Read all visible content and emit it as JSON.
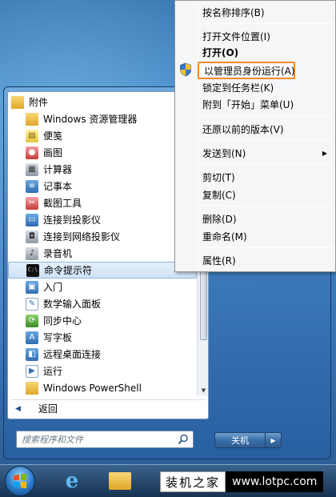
{
  "programs": {
    "folder_label": "附件",
    "items": [
      {
        "label": "Windows 资源管理器",
        "icon": "explorer-icon"
      },
      {
        "label": "便笺",
        "icon": "sticky-notes-icon"
      },
      {
        "label": "画图",
        "icon": "paint-icon"
      },
      {
        "label": "计算器",
        "icon": "calculator-icon"
      },
      {
        "label": "记事本",
        "icon": "notepad-icon"
      },
      {
        "label": "截图工具",
        "icon": "snipping-tool-icon"
      },
      {
        "label": "连接到投影仪",
        "icon": "projector-icon"
      },
      {
        "label": "连接到网络投影仪",
        "icon": "network-projector-icon"
      },
      {
        "label": "录音机",
        "icon": "microphone-icon"
      },
      {
        "label": "命令提示符",
        "icon": "cmd-icon",
        "selected": true
      },
      {
        "label": "入门",
        "icon": "getting-started-icon"
      },
      {
        "label": "数学输入面板",
        "icon": "math-input-icon"
      },
      {
        "label": "同步中心",
        "icon": "sync-icon"
      },
      {
        "label": "写字板",
        "icon": "wordpad-icon"
      },
      {
        "label": "远程桌面连接",
        "icon": "remote-desktop-icon"
      },
      {
        "label": "运行",
        "icon": "run-icon"
      },
      {
        "label": "Windows PowerShell",
        "icon": "folder-icon"
      }
    ],
    "cmd_icon_text": "C:\\",
    "back_label": "返回"
  },
  "search": {
    "placeholder": "搜索程序和文件"
  },
  "shutdown": {
    "label": "关机"
  },
  "context_menu": {
    "items": [
      {
        "label": "按名称排序(B)"
      },
      {
        "label": "打开文件位置(I)"
      },
      {
        "label": "打开(O)",
        "bold": true
      },
      {
        "label": "以管理员身份运行(A)",
        "highlighted": true,
        "icon": "uac-shield-icon"
      },
      {
        "label": "锁定到任务栏(K)"
      },
      {
        "label": "附到「开始」菜单(U)"
      },
      {
        "label": "还原以前的版本(V)"
      },
      {
        "label": "发送到(N)",
        "submenu": true
      },
      {
        "label": "剪切(T)"
      },
      {
        "label": "复制(C)"
      },
      {
        "label": "删除(D)"
      },
      {
        "label": "重命名(M)"
      },
      {
        "label": "属性(R)"
      }
    ]
  },
  "watermark": {
    "site_name": "装机之家",
    "url": "www.lotpc.com"
  },
  "colors": {
    "highlight_border": "#ef8a2d",
    "selection": "#cfe2f7"
  }
}
